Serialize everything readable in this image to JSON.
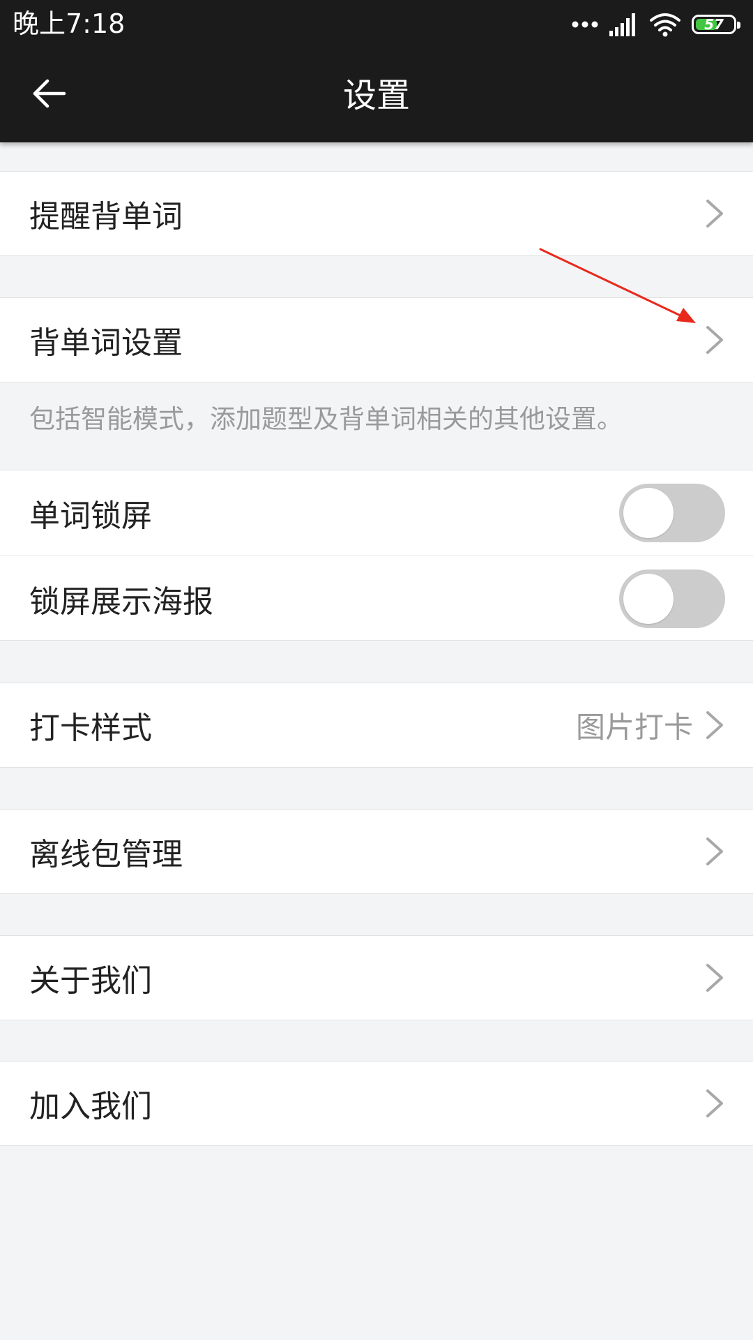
{
  "status_bar": {
    "time": "晚上7:18",
    "battery_level": "57",
    "battery_color": "#43c743"
  },
  "app_bar": {
    "title": "设置",
    "back_icon": "arrow-left-icon"
  },
  "settings": {
    "reminder": {
      "label": "提醒背单词"
    },
    "memorize_settings": {
      "label": "背单词设置",
      "hint": "包括智能模式，添加题型及背单词相关的其他设置。"
    },
    "word_lock_screen": {
      "label": "单词锁屏",
      "enabled": false
    },
    "lock_screen_poster": {
      "label": "锁屏展示海报",
      "enabled": false
    },
    "checkin_style": {
      "label": "打卡样式",
      "value": "图片打卡"
    },
    "offline_packages": {
      "label": "离线包管理"
    },
    "about_us": {
      "label": "关于我们"
    },
    "join_us": {
      "label": "加入我们"
    }
  },
  "colors": {
    "bar_background": "#1b1b1b",
    "page_background": "#f3f4f6",
    "toggle_off": "#cccccc",
    "annotation_arrow": "#e8291c"
  }
}
